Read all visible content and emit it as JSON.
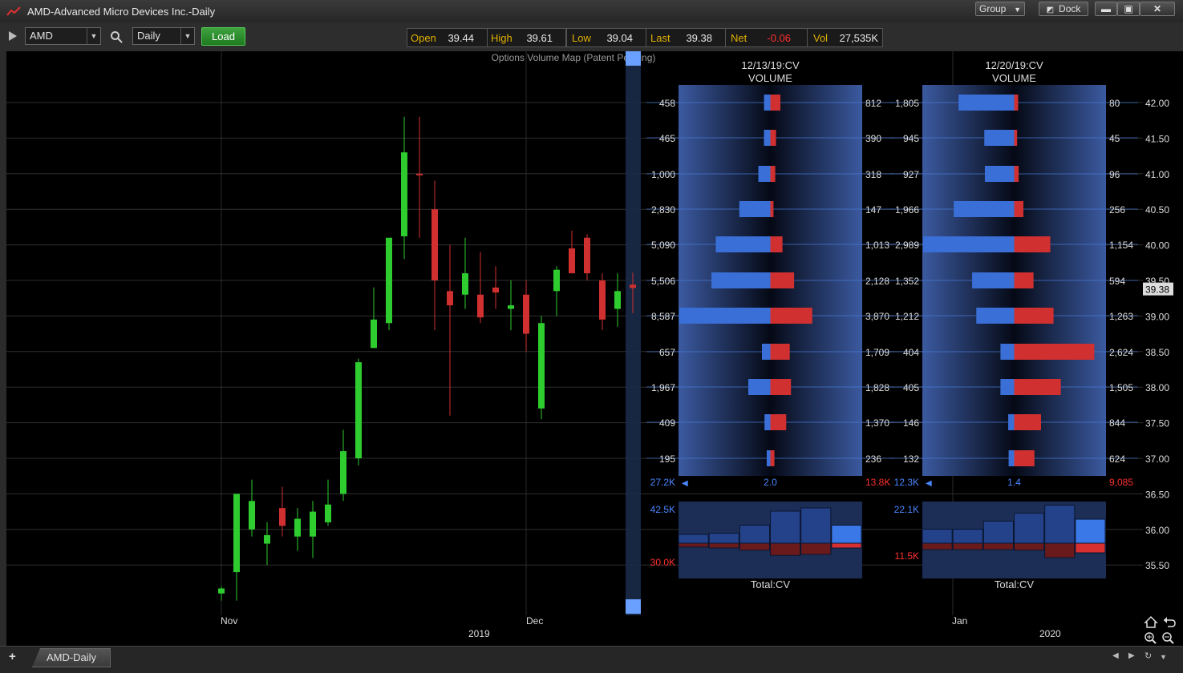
{
  "window": {
    "title": "AMD-Advanced Micro Devices Inc.-Daily",
    "group_label": "Group",
    "dock_label": "Dock"
  },
  "toolbar": {
    "symbol": "AMD",
    "interval": "Daily",
    "load_label": "Load"
  },
  "quote": [
    {
      "label": "Open",
      "value": "39.44",
      "color": "#e8e8e8"
    },
    {
      "label": "High",
      "value": "39.61",
      "color": "#e8e8e8"
    },
    {
      "label": "Low",
      "value": "39.04",
      "color": "#e8e8e8"
    },
    {
      "label": "Last",
      "value": "39.38",
      "color": "#e8e8e8"
    },
    {
      "label": "Net",
      "value": "-0.06",
      "color": "#ff3030"
    },
    {
      "label": "Vol",
      "value": "27,535K",
      "color": "#e8e8e8"
    }
  ],
  "chart": {
    "map_title": "Options Volume Map (Patent Pending)",
    "last_price_tag": "39.38",
    "price_ticks": [
      "42.00",
      "41.50",
      "41.00",
      "40.50",
      "40.00",
      "39.50",
      "39.00",
      "38.50",
      "38.00",
      "37.50",
      "37.00",
      "36.50",
      "36.00",
      "35.50"
    ],
    "x_labels": [
      "Nov",
      "Dec",
      "Jan"
    ],
    "year_labels": [
      "2019",
      "2020"
    ],
    "candles": [
      {
        "o": 35.1,
        "h": 35.2,
        "l": 35.0,
        "c": 35.17
      },
      {
        "o": 35.4,
        "h": 36.3,
        "l": 35.0,
        "c": 36.5
      },
      {
        "o": 36.0,
        "h": 36.7,
        "l": 35.9,
        "c": 36.4
      },
      {
        "o": 35.8,
        "h": 36.1,
        "l": 35.5,
        "c": 35.92
      },
      {
        "o": 36.3,
        "h": 36.6,
        "l": 35.9,
        "c": 36.05
      },
      {
        "o": 35.9,
        "h": 36.3,
        "l": 35.7,
        "c": 36.15
      },
      {
        "o": 35.9,
        "h": 36.4,
        "l": 35.6,
        "c": 36.25
      },
      {
        "o": 36.1,
        "h": 36.7,
        "l": 36.05,
        "c": 36.35
      },
      {
        "o": 36.5,
        "h": 37.4,
        "l": 36.4,
        "c": 37.1
      },
      {
        "o": 37.0,
        "h": 38.4,
        "l": 36.9,
        "c": 38.35
      },
      {
        "o": 38.55,
        "h": 39.4,
        "l": 38.55,
        "c": 38.95
      },
      {
        "o": 38.9,
        "h": 40.0,
        "l": 38.8,
        "c": 40.1
      },
      {
        "o": 40.12,
        "h": 41.8,
        "l": 39.8,
        "c": 41.3
      },
      {
        "o": 41.0,
        "h": 41.8,
        "l": 40.1,
        "c": 40.98
      },
      {
        "o": 40.5,
        "h": 40.9,
        "l": 38.8,
        "c": 39.5
      },
      {
        "o": 39.35,
        "h": 40.0,
        "l": 37.6,
        "c": 39.15
      },
      {
        "o": 39.3,
        "h": 40.1,
        "l": 39.1,
        "c": 39.6
      },
      {
        "o": 39.3,
        "h": 39.9,
        "l": 38.9,
        "c": 38.98
      },
      {
        "o": 39.4,
        "h": 39.7,
        "l": 39.1,
        "c": 39.33
      },
      {
        "o": 39.1,
        "h": 39.5,
        "l": 38.8,
        "c": 39.15
      },
      {
        "o": 39.3,
        "h": 39.5,
        "l": 38.5,
        "c": 38.75
      },
      {
        "o": 37.7,
        "h": 39.0,
        "l": 37.55,
        "c": 38.9
      },
      {
        "o": 39.35,
        "h": 39.7,
        "l": 39.0,
        "c": 39.65
      },
      {
        "o": 39.95,
        "h": 40.2,
        "l": 39.6,
        "c": 39.6
      },
      {
        "o": 40.1,
        "h": 40.15,
        "l": 39.5,
        "c": 39.6
      },
      {
        "o": 39.5,
        "h": 39.6,
        "l": 38.8,
        "c": 38.95
      },
      {
        "o": 39.1,
        "h": 39.6,
        "l": 38.85,
        "c": 39.35
      },
      {
        "o": 39.44,
        "h": 39.61,
        "l": 39.04,
        "c": 39.38
      }
    ],
    "panels": [
      {
        "header_date": "12/13/19:CV",
        "header_sub": "VOLUME",
        "strikes": [
          {
            "put": "458",
            "call": "812",
            "p": 458,
            "c": 812
          },
          {
            "put": "465",
            "call": "390",
            "p": 465,
            "c": 390
          },
          {
            "put": "1,000",
            "call": "318",
            "p": 1000,
            "c": 318
          },
          {
            "put": "2,830",
            "call": "147",
            "p": 2830,
            "c": 147
          },
          {
            "put": "5,090",
            "call": "1,013",
            "p": 5090,
            "c": 1013
          },
          {
            "put": "5,506",
            "call": "2,128",
            "p": 5506,
            "c": 2128
          },
          {
            "put": "8,587",
            "call": "3,870",
            "p": 8587,
            "c": 3870
          },
          {
            "put": "657",
            "call": "1,709",
            "p": 657,
            "c": 1709
          },
          {
            "put": "1,967",
            "call": "1,828",
            "p": 1967,
            "c": 1828
          },
          {
            "put": "409",
            "call": "1,370",
            "p": 409,
            "c": 1370
          },
          {
            "put": "195",
            "call": "236",
            "p": 195,
            "c": 236
          }
        ],
        "total_put": "27.2K",
        "ratio": "2.0",
        "total_call": "13.8K",
        "hist_top": "42.5K",
        "hist_bottom": "30.0K",
        "hist_label": "Total:CV",
        "hist": [
          [
            0.22,
            0.12
          ],
          [
            0.25,
            0.15
          ],
          [
            0.45,
            0.22
          ],
          [
            0.8,
            0.38
          ],
          [
            0.88,
            0.35
          ],
          [
            0.45,
            0.15
          ]
        ]
      },
      {
        "header_date": "12/20/19:CV",
        "header_sub": "VOLUME",
        "strikes": [
          {
            "put": "1,805",
            "call": "80",
            "p": 1805,
            "c": 80
          },
          {
            "put": "945",
            "call": "45",
            "p": 945,
            "c": 45
          },
          {
            "put": "927",
            "call": "96",
            "p": 927,
            "c": 96
          },
          {
            "put": "1,966",
            "call": "256",
            "p": 1966,
            "c": 256
          },
          {
            "put": "2,989",
            "call": "1,154",
            "p": 2989,
            "c": 1154
          },
          {
            "put": "1,352",
            "call": "594",
            "p": 1352,
            "c": 594
          },
          {
            "put": "1,212",
            "call": "1,263",
            "p": 1212,
            "c": 1263
          },
          {
            "put": "404",
            "call": "2,624",
            "p": 404,
            "c": 2624
          },
          {
            "put": "405",
            "call": "1,505",
            "p": 405,
            "c": 1505
          },
          {
            "put": "146",
            "call": "844",
            "p": 146,
            "c": 844
          },
          {
            "put": "132",
            "call": "624",
            "p": 132,
            "c": 624
          }
        ],
        "total_put": "12.3K",
        "ratio": "1.4",
        "total_call": "9,085",
        "hist_top": "22.1K",
        "hist_bottom": "11.5K",
        "hist_label": "Total:CV",
        "hist": [
          [
            0.35,
            0.2
          ],
          [
            0.35,
            0.2
          ],
          [
            0.55,
            0.2
          ],
          [
            0.75,
            0.22
          ],
          [
            0.95,
            0.45
          ],
          [
            0.6,
            0.3
          ]
        ]
      }
    ]
  },
  "tabs": {
    "active": "AMD-Daily"
  },
  "colors": {
    "up": "#2ecc2e",
    "down": "#d03030",
    "put": "#3a6fd8",
    "call": "#d03030",
    "accent": "#e0b000"
  }
}
